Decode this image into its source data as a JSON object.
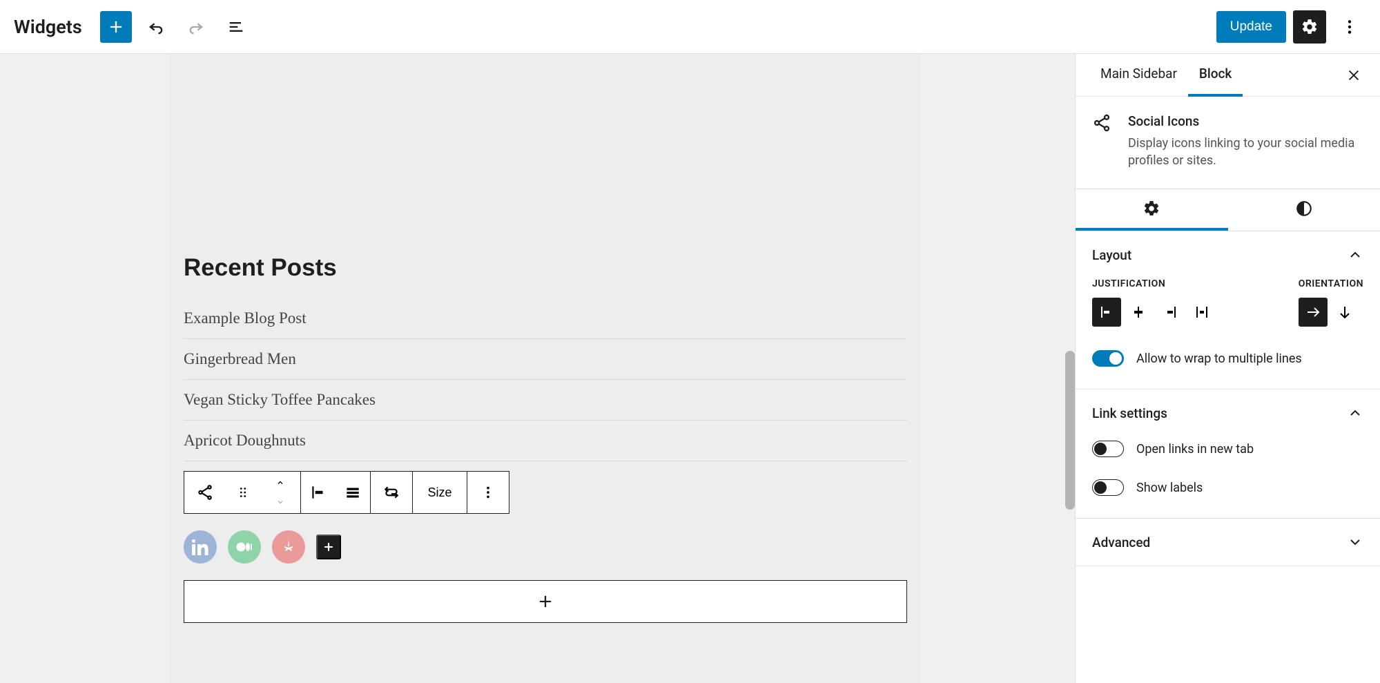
{
  "header": {
    "title": "Widgets",
    "update_label": "Update"
  },
  "canvas": {
    "recent_posts_heading": "Recent Posts",
    "posts": [
      "Example Blog Post",
      "Gingerbread Men",
      "Vegan Sticky Toffee Pancakes",
      "Apricot Doughnuts"
    ],
    "toolbar": {
      "size_label": "Size"
    },
    "social_icons": {
      "linkedin": "linkedin",
      "medium": "medium",
      "yelp": "yelp"
    }
  },
  "sidebar": {
    "tabs": {
      "main_sidebar": "Main Sidebar",
      "block": "Block"
    },
    "block_info": {
      "title": "Social Icons",
      "description": "Display icons linking to your social media profiles or sites."
    },
    "layout": {
      "panel_title": "Layout",
      "justification_label": "JUSTIFICATION",
      "orientation_label": "ORIENTATION",
      "wrap_label": "Allow to wrap to multiple lines",
      "wrap_on": true
    },
    "link_settings": {
      "panel_title": "Link settings",
      "open_new_tab_label": "Open links in new tab",
      "open_new_tab_on": false,
      "show_labels_label": "Show labels",
      "show_labels_on": false
    },
    "advanced": {
      "panel_title": "Advanced"
    }
  }
}
